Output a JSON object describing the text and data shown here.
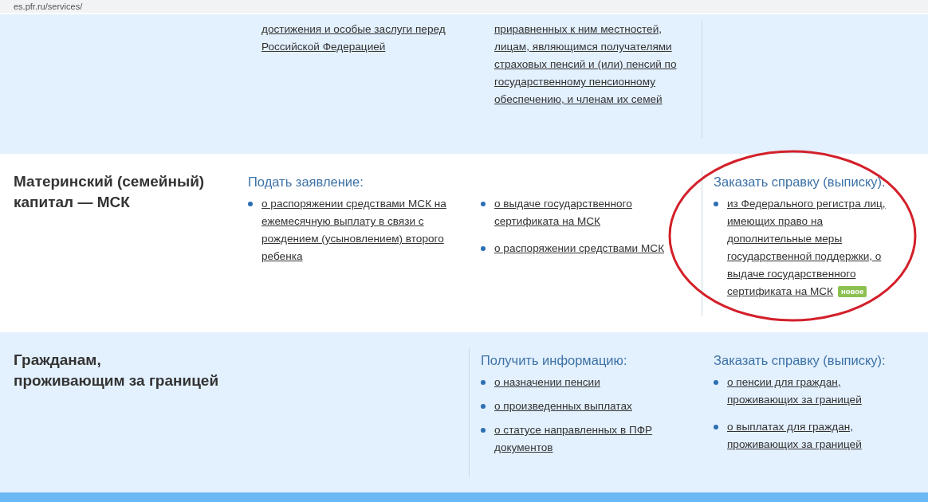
{
  "address_bar": {
    "url": "es.pfr.ru/services/"
  },
  "sections": [
    {
      "color": "#e3f0fe",
      "columns": [
        {
          "circled": false,
          "divider": false,
          "items": [
            {
              "text": "достижения и особые заслуги перед Российской Федерацией",
              "bullet": false
            }
          ]
        },
        {
          "circled": false,
          "divider": false,
          "items": [
            {
              "text": "приравненных к ним местностей, лицам, являющимся получателями страховых пенсий и (или) пенсий по государственному пенсионному обеспечению, и членам их семей",
              "bullet": false
            }
          ]
        },
        {
          "circled": false,
          "divider": true
        }
      ]
    },
    {
      "color": "#ffffff",
      "title": "Материнский (семейный) капитал — МСК",
      "columns": [
        {
          "circled": false,
          "divider": false,
          "heading": "Подать заявление:",
          "items": [
            {
              "text": "о распоряжении средствами МСК на ежемесячную выплату в связи с рождением (усыновлением) второго ребенка",
              "bullet": true
            }
          ]
        },
        {
          "circled": false,
          "divider": false,
          "items": [
            {
              "text": "о выдаче государственного сертификата на МСК",
              "bullet": true
            },
            {
              "text": "о распоряжении средствами МСК",
              "bullet": true
            }
          ]
        },
        {
          "circled": true,
          "divider": true,
          "heading": "Заказать справку (выписку):",
          "items": [
            {
              "text": "из Федерального регистра лиц, имеющих право на дополнительные меры государственной поддержки, о выдаче государственного сертификата на МСК",
              "bullet": true,
              "badge": "новое"
            }
          ]
        }
      ]
    },
    {
      "color": "#e3f0fe",
      "title": "Гражданам,\nпроживающим за границей",
      "columns": [
        {
          "circled": false,
          "divider": false
        },
        {
          "circled": false,
          "divider": true,
          "heading": "Получить информацию:",
          "items": [
            {
              "text": "о назначении пенсии",
              "bullet": true
            },
            {
              "text": "о произведенных выплатах",
              "bullet": true
            },
            {
              "text": "о статусе направленных в ПФР документов",
              "bullet": true
            }
          ]
        },
        {
          "circled": false,
          "divider": false,
          "heading": "Заказать справку (выписку):",
          "items": [
            {
              "text": "о пенсии для граждан, проживающих за границей",
              "bullet": true
            },
            {
              "text": "о выплатах для граждан, проживающих за границей",
              "bullet": true
            }
          ]
        }
      ]
    }
  ]
}
